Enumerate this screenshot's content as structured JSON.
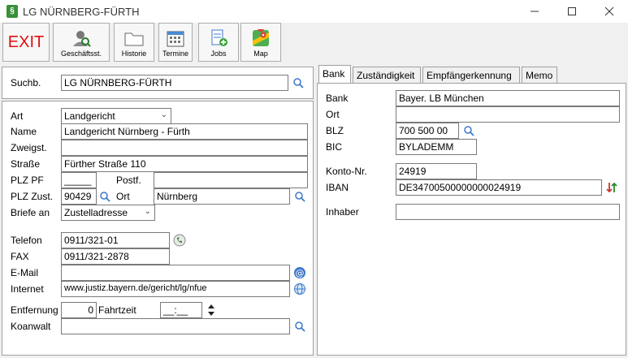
{
  "window": {
    "title": "LG NÜRNBERG-FÜRTH",
    "app_icon": "§"
  },
  "toolbar": {
    "exit": "EXIT",
    "geschaeftsst": "Geschäftsst.",
    "historie": "Historie",
    "termine": "Termine",
    "jobs": "Jobs",
    "map": "Map"
  },
  "search": {
    "label": "Suchb.",
    "value": "LG NÜRNBERG-FÜRTH"
  },
  "form": {
    "art_label": "Art",
    "art_value": "Landgericht",
    "name_label": "Name",
    "name_value": "Landgericht Nürnberg - Fürth",
    "zweigst_label": "Zweigst.",
    "zweigst_value": "",
    "strasse_label": "Straße",
    "strasse_value": "Fürther Straße 110",
    "plzpf_label": "PLZ PF",
    "plzpf_value": "_____",
    "postf_label": "Postf.",
    "postf_value": "",
    "plzzust_label": "PLZ Zust.",
    "plzzust_value": "90429",
    "ort_label": "Ort",
    "ort_value": "Nürnberg",
    "briefe_label": "Briefe an",
    "briefe_value": "Zustelladresse",
    "telefon_label": "Telefon",
    "telefon_value": "0911/321-01",
    "fax_label": "FAX",
    "fax_value": "0911/321-2878",
    "email_label": "E-Mail",
    "email_value": "",
    "internet_label": "Internet",
    "internet_value": "www.justiz.bayern.de/gericht/lg/nfue",
    "entfernung_label": "Entfernung",
    "entfernung_value": "0",
    "fahrzeit_label": "Fahrtzeit",
    "fahrzeit_value": "__:__",
    "koanwalt_label": "Koanwalt",
    "koanwalt_value": ""
  },
  "tabs": {
    "bank": "Bank",
    "zustaendigkeit": "Zuständigkeit",
    "empfaenger": "Empfängerkennung",
    "memo": "Memo"
  },
  "bank": {
    "bank_label": "Bank",
    "bank_value": "Bayer. LB München",
    "ort_label": "Ort",
    "ort_value": "",
    "blz_label": "BLZ",
    "blz_value": "700 500 00",
    "bic_label": "BIC",
    "bic_value": "BYLADEMM",
    "konto_label": "Konto-Nr.",
    "konto_value": "24919",
    "iban_label": "IBAN",
    "iban_value": "DE34700500000000024919",
    "inhaber_label": "Inhaber",
    "inhaber_value": ""
  },
  "colors": {
    "exit_red": "#e01010",
    "accent_blue": "#3c78c8"
  }
}
